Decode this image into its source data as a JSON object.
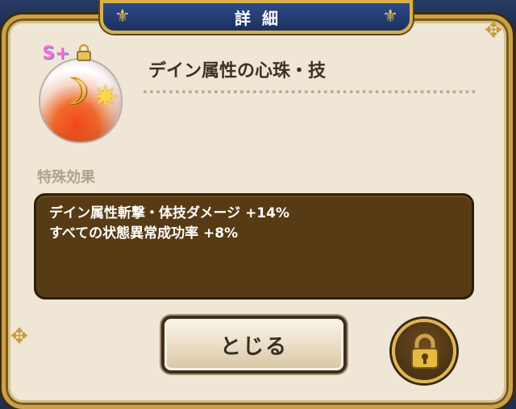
{
  "header": {
    "title": "詳細"
  },
  "item": {
    "name": "デイン属性の心珠・技",
    "rank_badge": "S+",
    "locked": true,
    "icon_name": "orb-icon"
  },
  "effects": {
    "label": "特殊効果",
    "lines": [
      "デイン属性斬撃・体技ダメージ +14%",
      "すべての状態異常成功率 +8%"
    ]
  },
  "buttons": {
    "close_label": "とじる",
    "lock_icon": "lock-icon"
  },
  "colors": {
    "panel_bg": "#efe6d6",
    "frame_gold": "#caa144",
    "title_bar": "#2d4a86",
    "effect_box": "#573b14"
  }
}
